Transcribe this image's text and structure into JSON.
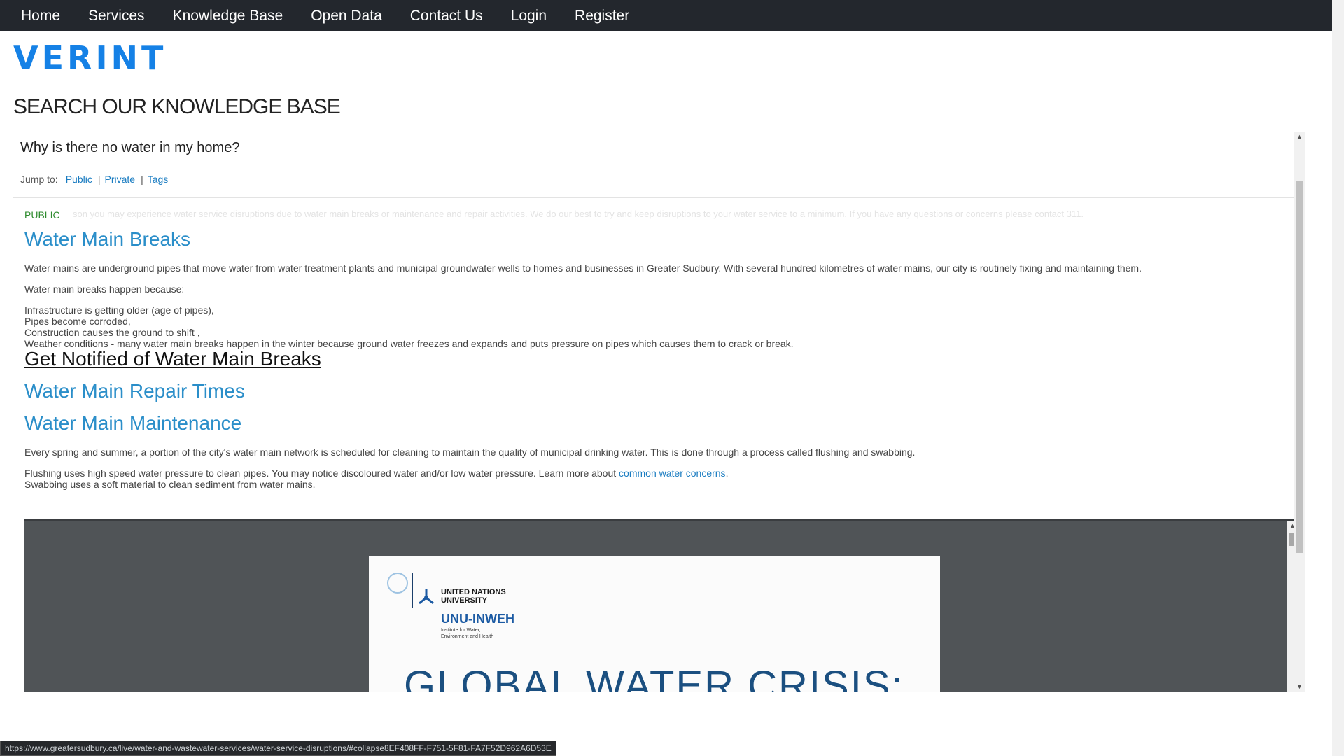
{
  "nav": {
    "items": [
      "Home",
      "Services",
      "Knowledge Base",
      "Open Data",
      "Contact Us",
      "Login",
      "Register"
    ]
  },
  "logo": "VERINT",
  "page_title": "SEARCH OUR KNOWLEDGE BASE",
  "question": "Why is there no water in my home?",
  "jump": {
    "label": "Jump to:",
    "links": [
      "Public",
      "Private",
      "Tags"
    ]
  },
  "ghost_text": "son you may experience water service disruptions due to water main breaks or maintenance and repair activities. We do our best to try and keep disruptions to your water service to a minimum. If you have any questions or concerns please contact 311.",
  "section_label": "PUBLIC",
  "article": {
    "h1": "Water Main Breaks",
    "p1": "Water mains are underground pipes that move water from water treatment plants and municipal groundwater wells to homes and businesses in Greater Sudbury. With several hundred kilometres of water mains, our city is routinely fixing and maintaining them.",
    "p2": "Water main breaks happen because:",
    "list": [
      "Infrastructure is getting older (age of pipes),",
      "Pipes become corroded,",
      "Construction causes the ground to shift ,",
      "Weather conditions - many water main breaks happen in the winter because ground water freezes and expands and puts pressure on pipes which causes them to crack or break."
    ],
    "h2": "Get Notified of Water Main Breaks",
    "h3": "Water Main Repair Times",
    "h4": "Water Main Maintenance",
    "p3": "Every spring and summer, a portion of the city's water main network is scheduled for cleaning to maintain the quality of municipal drinking water. This is done through a process called flushing and swabbing.",
    "p4_before": "Flushing uses high speed water pressure to clean pipes. You may notice discoloured water and/or low water pressure. Learn more about ",
    "p4_link": "common water concerns",
    "p4_after": ".",
    "p5": "Swabbing uses a soft material to clean sediment from water mains."
  },
  "pdf": {
    "un_name_1": "UNITED NATIONS",
    "un_name_2": "UNIVERSITY",
    "unu_inweh": "UNU-INWEH",
    "unu_sub_1": "Institute for Water,",
    "unu_sub_2": "Environment and Health",
    "big_title": "GLOBAL WATER CRISIS:"
  },
  "status_url": "https://www.greatersudbury.ca/live/water-and-wastewater-services/water-service-disruptions/#collapse8EF408FF-F751-5F81-FA7F52D962A6D53E",
  "colors": {
    "nav_bg": "#23272d",
    "logo": "#1581e6",
    "link": "#2a8ec9",
    "public_label": "#2e8b2e"
  }
}
